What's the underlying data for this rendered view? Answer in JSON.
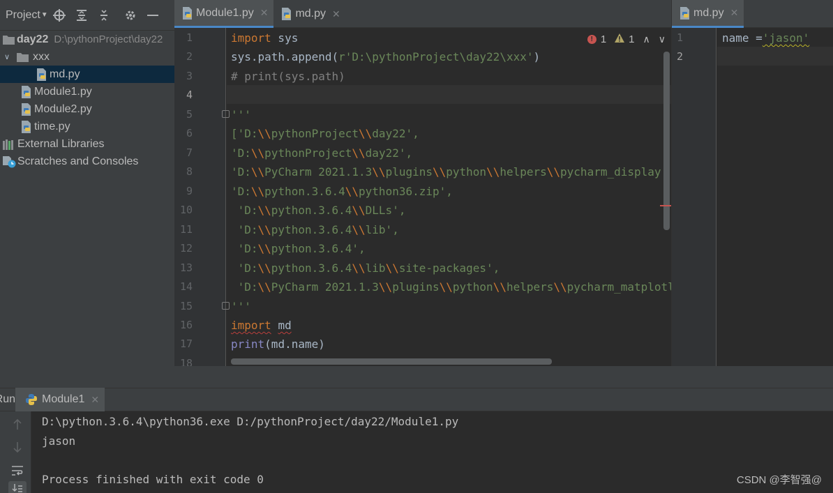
{
  "project_panel": {
    "title": "Project",
    "toolbar_icons": [
      "locate-icon",
      "expand-all-icon",
      "collapse-all-icon",
      "gear-icon",
      "hide-icon"
    ],
    "tree": [
      {
        "label": "day22",
        "path": "D:\\pythonProject\\day22",
        "type": "folder",
        "expanded": true
      },
      {
        "label": "xxx",
        "type": "folder",
        "expanded": true
      },
      {
        "label": "md.py",
        "type": "python-file",
        "selected": true
      },
      {
        "label": "Module1.py",
        "type": "python-file"
      },
      {
        "label": "Module2.py",
        "type": "python-file"
      },
      {
        "label": "time.py",
        "type": "python-file"
      },
      {
        "label": "External Libraries",
        "type": "library"
      },
      {
        "label": "Scratches and Consoles",
        "type": "scratches"
      }
    ]
  },
  "editor_tabs": [
    {
      "label": "Module1.py",
      "active": true
    },
    {
      "label": "md.py",
      "active": false
    }
  ],
  "right_tabs": [
    {
      "label": "md.py",
      "active": true
    }
  ],
  "inspection": {
    "errors": "1",
    "warnings": "1"
  },
  "editor": {
    "line_numbers": [
      "1",
      "2",
      "3",
      "4",
      "5",
      "6",
      "7",
      "8",
      "9",
      "10",
      "11",
      "12",
      "13",
      "14",
      "15",
      "16",
      "17",
      "18"
    ]
  },
  "right_editor": {
    "line_numbers": [
      "1",
      "2"
    ]
  },
  "run_panel": {
    "label": "Run:",
    "tab": "Module1",
    "console": [
      "D:\\python.3.6.4\\python36.exe D:/pythonProject/day22/Module1.py",
      "jason",
      "",
      "Process finished with exit code 0"
    ]
  },
  "watermark": "CSDN @李智强@",
  "colors": {
    "keyword": "#cc7832",
    "string": "#6a8759",
    "comment": "#808080",
    "background": "#2b2b2b",
    "panel": "#3c3f41"
  }
}
